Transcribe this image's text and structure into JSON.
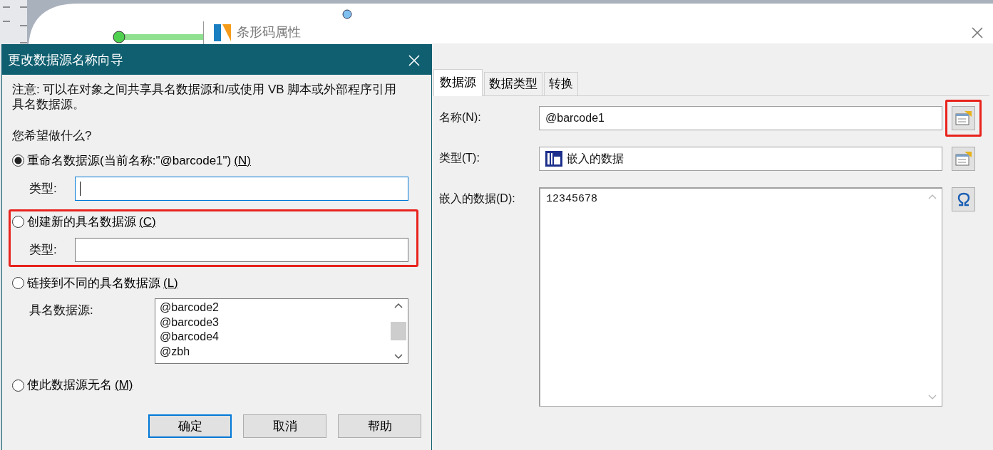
{
  "barcode_window": {
    "title": "条形码属性",
    "tabs": [
      {
        "label": "数据源",
        "selected": true
      },
      {
        "label": "数据类型",
        "selected": false
      },
      {
        "label": "转换",
        "selected": false
      }
    ],
    "fields": [
      {
        "kind": "text",
        "label": "名称(N):",
        "value": "@barcode1",
        "highlighted": true
      },
      {
        "kind": "type",
        "label": "类型(T):",
        "value": "嵌入的数据",
        "highlighted": false
      },
      {
        "kind": "area",
        "label": "嵌入的数据(D):",
        "value": "12345678",
        "highlighted": false
      }
    ]
  },
  "wizard": {
    "title": "更改数据源名称向导",
    "note": "注意: 可以在对象之间共享具名数据源和/或使用 VB 脚本或外部程序引用具名数据源。",
    "question": "您希望做什么?",
    "options": [
      {
        "kind": "field",
        "label": "重命名数据源(当前名称:\"@barcode1\")",
        "mnemonic": "(N)",
        "selected": true,
        "field_label": "类型:",
        "focused": true,
        "highlighted": false
      },
      {
        "kind": "field",
        "label": "创建新的具名数据源",
        "mnemonic": "(C)",
        "selected": false,
        "field_label": "类型:",
        "focused": false,
        "highlighted": true
      },
      {
        "kind": "list",
        "label": "链接到不同的具名数据源",
        "mnemonic": "(L)",
        "selected": false,
        "list_label": "具名数据源:",
        "items": [
          "@barcode2",
          "@barcode3",
          "@barcode4",
          "@zbh"
        ],
        "highlighted": false
      },
      {
        "kind": "plain",
        "label": "使此数据源无名",
        "mnemonic": "(M)",
        "selected": false,
        "highlighted": false
      }
    ],
    "buttons": [
      {
        "label": "确定",
        "default": true
      },
      {
        "label": "取消",
        "default": false
      },
      {
        "label": "帮助",
        "default": false
      }
    ]
  }
}
